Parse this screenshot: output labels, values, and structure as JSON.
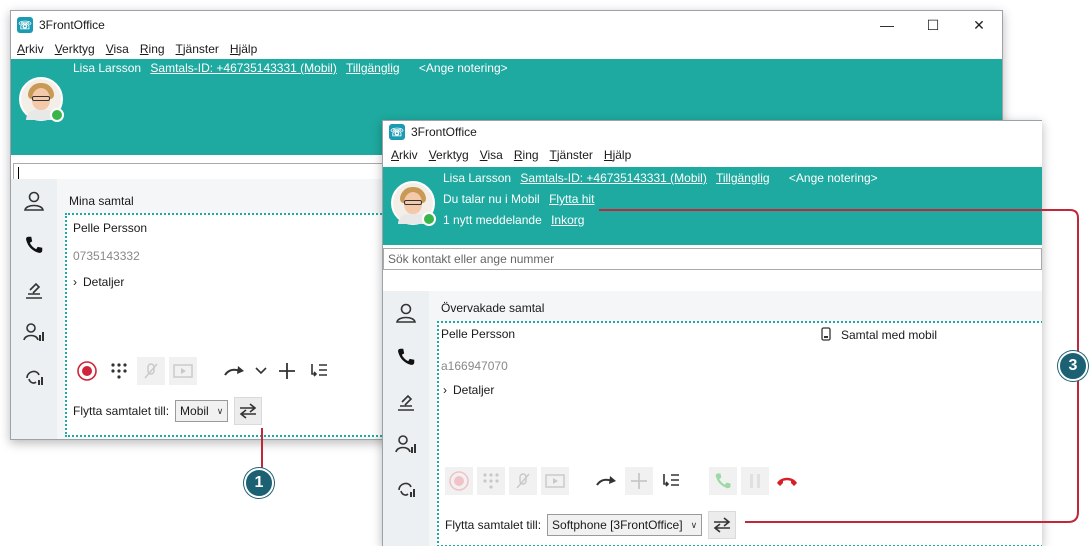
{
  "app": {
    "title": "3FrontOffice"
  },
  "menu": [
    "Arkiv",
    "Verktyg",
    "Visa",
    "Ring",
    "Tjänster",
    "Hjälp"
  ],
  "user": {
    "name": "Lisa Larsson",
    "caller_id": "Samtals-ID: +46735143331 (Mobil)",
    "status": "Tillgänglig",
    "note": "<Ange notering>"
  },
  "windowA": {
    "search_value": "",
    "section_title": "Mina samtal",
    "call": {
      "name": "Pelle Persson",
      "number": "0735143332",
      "details": "Detaljer"
    },
    "move_label": "Flytta samtalet till:",
    "move_selected": "Mobil"
  },
  "windowB": {
    "mobile_text": "Du talar nu i Mobil",
    "move_here": "Flytta hit",
    "messages_text": "1 nytt meddelande",
    "inbox": "Inkorg",
    "search_placeholder": "Sök kontakt eller ange nummer",
    "section_title": "Övervakade samtal",
    "call": {
      "name": "Pelle Persson",
      "number": "a166947070",
      "details": "Detaljer",
      "status": "Samtal med mobil"
    },
    "move_label": "Flytta samtalet till:",
    "move_selected": "Softphone [3FrontOffice]"
  },
  "callouts": {
    "one": "1",
    "three": "3"
  },
  "colors": {
    "teal": "#1eaaa0",
    "badge": "#1c6173",
    "callout_line": "#c0283a",
    "record": "#d0243a",
    "hangup": "#d91f26",
    "answer": "#39b54a"
  }
}
